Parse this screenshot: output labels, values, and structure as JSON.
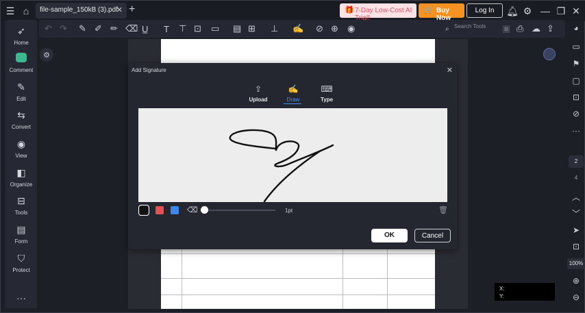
{
  "titlebar": {
    "file_tab": "file-sample_150kB (3).pdf",
    "promo": "7-Day Low-Cost AI Trial!",
    "buy": "Buy Now",
    "login": "Log In"
  },
  "toolbar": {
    "search_placeholder": "Search Tools"
  },
  "sidebar": {
    "items": [
      {
        "label": "Home",
        "icon": "rocket-icon"
      },
      {
        "label": "Comment",
        "icon": "comment-icon"
      },
      {
        "label": "Edit",
        "icon": "edit-icon"
      },
      {
        "label": "Convert",
        "icon": "convert-icon"
      },
      {
        "label": "View",
        "icon": "eye-icon"
      },
      {
        "label": "Organize",
        "icon": "organize-icon"
      },
      {
        "label": "Tools",
        "icon": "toolbox-icon"
      },
      {
        "label": "Form",
        "icon": "form-icon"
      },
      {
        "label": "Protect",
        "icon": "shield-icon"
      }
    ]
  },
  "pager": {
    "current": "2",
    "total": "4",
    "zoom": "100%"
  },
  "dialog": {
    "title": "Add Signature",
    "modes": [
      "Upload",
      "Draw",
      "Type"
    ],
    "active_mode": "Draw",
    "pen_colors": [
      "#111111",
      "#e45353",
      "#3d86ef"
    ],
    "stroke_width": "1pt",
    "ok": "OK",
    "cancel": "Cancel"
  },
  "coords": {
    "x_label": "X:",
    "y_label": "Y:"
  },
  "colors": {
    "accent": "#4a8df6",
    "buy": "#f59221",
    "promo_bg": "#fde3e6",
    "comment": "#3ab88e"
  }
}
